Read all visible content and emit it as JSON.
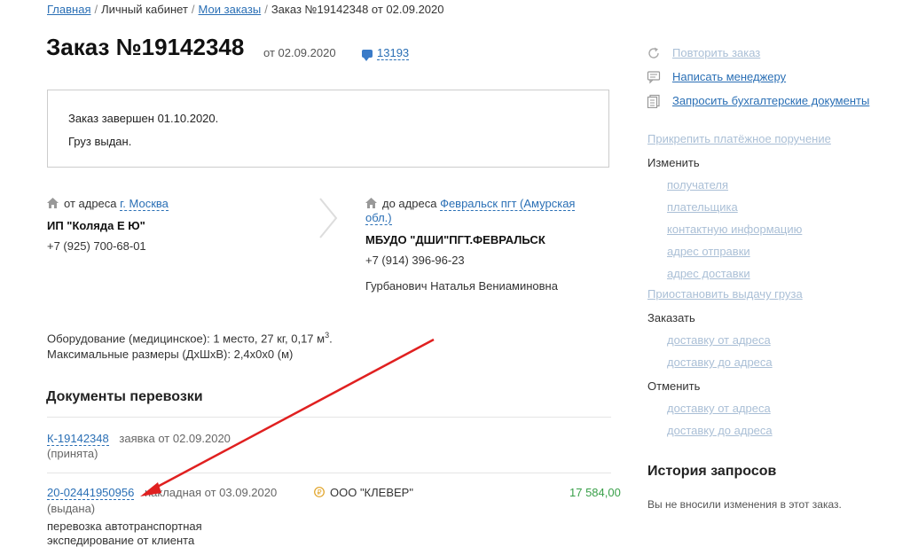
{
  "breadcrumb": {
    "home": "Главная",
    "cabinet": "Личный кабинет",
    "orders": "Мои заказы",
    "current": "Заказ №19142348 от 02.09.2020"
  },
  "order": {
    "title": "Заказ №19142348",
    "date": "от 02.09.2020",
    "comments_count": "13193"
  },
  "status": {
    "line1": "Заказ завершен 01.10.2020.",
    "line2": "Груз выдан."
  },
  "from": {
    "label": "от адреса",
    "city": "г. Москва",
    "name": "ИП \"Коляда Е Ю\"",
    "phone": "+7 (925) 700-68-01"
  },
  "to": {
    "label": "до адреса",
    "city_line1": "Февральск пгт (Амурская",
    "city_line2": "обл.)",
    "name": "МБУДО \"ДШИ\"ПГТ.ФЕВРАЛЬСК",
    "phone": "+7 (914) 396-96-23",
    "contact": "Гурбанович Наталья Вениаминовна"
  },
  "cargo": {
    "line1": "Оборудование (медицинское): 1 место, 27 кг, 0,17 м",
    "line1_sup": "3",
    "line1_end": ".",
    "line2": "Максимальные размеры (ДхШхВ): 2,4х0х0 (м)"
  },
  "documents": {
    "title": "Документы перевозки",
    "items": [
      {
        "number": "К-19142348",
        "desc": "заявка от 02.09.2020",
        "state": "(принята)"
      },
      {
        "number": "20-02441950956",
        "desc": "накладная от 03.09.2020",
        "company": "ООО \"КЛЕВЕР\"",
        "amount": "17 584,00",
        "state": "(выдана)",
        "service_line1": "перевозка автотранспортная",
        "service_line2": "экспедирование от клиента"
      }
    ]
  },
  "sidebar": {
    "repeat": "Повторить заказ",
    "write_manager": "Написать менеджеру",
    "request_docs": "Запросить бухгалтерские документы",
    "attach_payment": "Прикрепить платёжное поручение",
    "change": "Изменить",
    "change_items": [
      "получателя",
      "плательщика",
      "контактную информацию",
      "адрес отправки",
      "адрес доставки"
    ],
    "suspend": "Приостановить выдачу груза",
    "order_head": "Заказать",
    "order_items": [
      "доставку от адреса",
      "доставку до адреса"
    ],
    "cancel_head": "Отменить",
    "cancel_items": [
      "доставку от адреса",
      "доставку до адреса"
    ],
    "history_title": "История запросов",
    "history_text": "Вы не вносили изменения в этот заказ."
  },
  "colors": {
    "link": "#2a6fb5",
    "disabled_link": "#aabfd6",
    "amount": "#3aa04a",
    "arrow": "#e02020"
  }
}
